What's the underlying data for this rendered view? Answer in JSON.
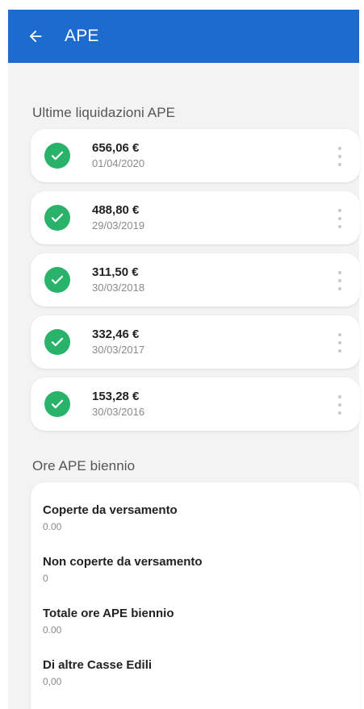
{
  "app_bar": {
    "title": "APE",
    "back_icon": "arrow-left-icon",
    "background_color": "#1e6bd0"
  },
  "liquidazioni": {
    "section_title": "Ultime liquidazioni APE",
    "items": [
      {
        "amount": "656,06 €",
        "date": "01/04/2020",
        "status_icon": "check-circle-icon"
      },
      {
        "amount": "488,80 €",
        "date": "29/03/2019",
        "status_icon": "check-circle-icon"
      },
      {
        "amount": "311,50 €",
        "date": "30/03/2018",
        "status_icon": "check-circle-icon"
      },
      {
        "amount": "332,46 €",
        "date": "30/03/2017",
        "status_icon": "check-circle-icon"
      },
      {
        "amount": "153,28 €",
        "date": "30/03/2016",
        "status_icon": "check-circle-icon"
      }
    ],
    "status_color": "#29b36a"
  },
  "ore_biennio": {
    "section_title": "Ore APE biennio",
    "items": [
      {
        "label": "Coperte da versamento",
        "value": "0.00"
      },
      {
        "label": "Non coperte da versamento",
        "value": "0"
      },
      {
        "label": "Totale ore APE biennio",
        "value": "0.00"
      },
      {
        "label": "Di altre Casse Edili",
        "value": "0,00"
      }
    ]
  }
}
